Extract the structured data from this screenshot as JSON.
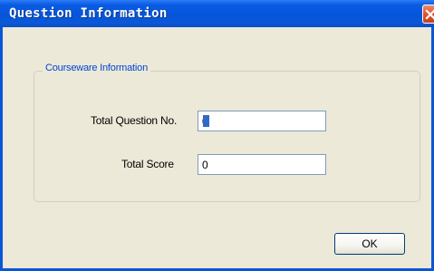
{
  "window": {
    "title": "Question Information",
    "close_icon": "close-x-icon"
  },
  "group": {
    "legend": "Courseware Information"
  },
  "fields": {
    "total_question": {
      "label": "Total Question No.",
      "value": "0"
    },
    "total_score": {
      "label": "Total Score",
      "value": "0"
    }
  },
  "buttons": {
    "ok_label": "OK"
  },
  "colors": {
    "titlebar": "#0654d9",
    "legend_text": "#0046d5",
    "close_button": "#e0532c",
    "dialog_background": "#ece9d8"
  }
}
